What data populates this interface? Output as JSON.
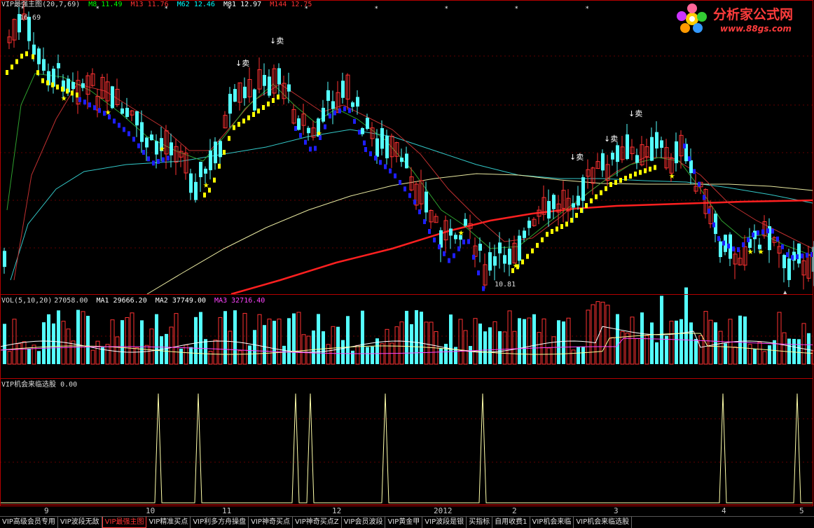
{
  "main_panel": {
    "title": "VIP最强主图",
    "params": "(20,7,69)",
    "indicators": [
      {
        "label": "M8",
        "value": "11.49",
        "color": "#00ff00"
      },
      {
        "label": "M13",
        "value": "11.76",
        "color": "#ff3333"
      },
      {
        "label": "M62",
        "value": "12.46",
        "color": "#00ffff"
      },
      {
        "label": "M81",
        "value": "12.97",
        "color": "#ffffff"
      },
      {
        "label": "M144",
        "value": "12.75",
        "color": "#ff3333"
      }
    ],
    "high_label": "16.69",
    "low_label": "10.81",
    "sell_marks": [
      "↓卖",
      "↓卖",
      "↓卖",
      "↓卖",
      "↓卖"
    ]
  },
  "volume_panel": {
    "name": "VOL(5,10,20)",
    "value": "27058.00",
    "ma": [
      {
        "label": "MA1",
        "value": "29666.20",
        "color": "#ffffff"
      },
      {
        "label": "MA2",
        "value": "37749.00",
        "color": "#ffffff"
      },
      {
        "label": "MA3",
        "value": "32716.40",
        "color": "#ff44ff"
      }
    ]
  },
  "signal_panel": {
    "name": "VIP机会来临选股",
    "value": "0.00"
  },
  "x_axis": [
    "9",
    "10",
    "11",
    "12",
    "2012",
    "2",
    "3",
    "4",
    "5"
  ],
  "logo": {
    "name": "分析家公式网",
    "url_text": "www.88gs.com"
  },
  "tabs": [
    {
      "label": "VIP高级会员专用",
      "active": false
    },
    {
      "label": "VIP波段无敌",
      "active": false
    },
    {
      "label": "VIP最强主图",
      "active": true
    },
    {
      "label": "VIP精准买点",
      "active": false
    },
    {
      "label": "VIP利多方舟操盘",
      "active": false
    },
    {
      "label": "VIP神奇买点",
      "active": false
    },
    {
      "label": "VIP神奇买点Z",
      "active": false
    },
    {
      "label": "VIP会员波段",
      "active": false
    },
    {
      "label": "VIP黄金甲",
      "active": false
    },
    {
      "label": "VIP波段是银",
      "active": false
    },
    {
      "label": "买指标",
      "active": false
    },
    {
      "label": "自用收费1",
      "active": false
    },
    {
      "label": "VIP机会来临",
      "active": false
    },
    {
      "label": "VIP机会来临选股",
      "active": false
    }
  ],
  "colors": {
    "up_candle": "#ff3232",
    "down_candle": "#54ffff",
    "band_yellow": "#ffff00",
    "band_blue": "#1e1eff",
    "signal_line": "#ffffaa",
    "star": "#ffff00"
  }
}
